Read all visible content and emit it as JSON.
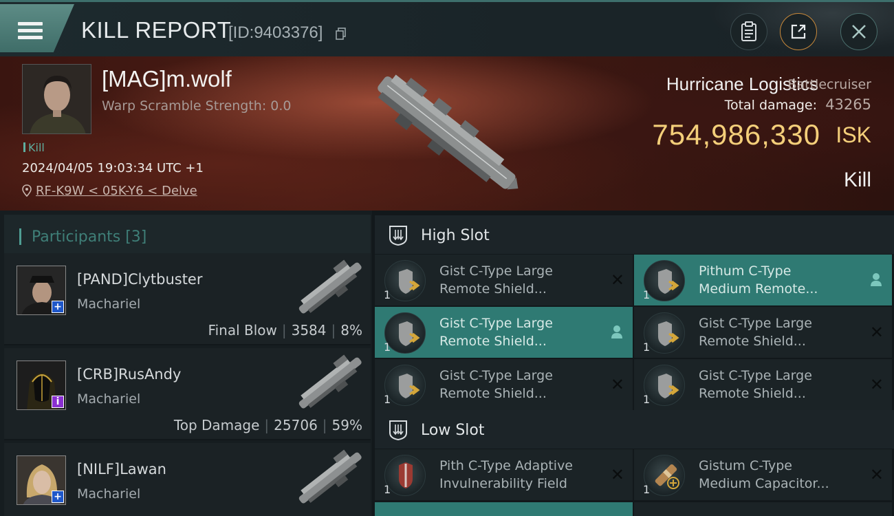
{
  "header": {
    "title": "KILL REPORT",
    "report_id": "[ID:9403376]",
    "icons": [
      "menu-icon",
      "copy-icon",
      "clipboard-icon",
      "share-icon",
      "close-icon"
    ]
  },
  "victim": {
    "name": "[MAG]m.wolf",
    "warp": "Warp Scramble Strength: 0.0",
    "tag": "Kill",
    "datetime": "2024/04/05 19:03:34 UTC +1",
    "location": "RF-K9W < 05K-Y6 < Delve",
    "ship_name": "Hurricane Logistics",
    "ship_class": "Battlecruiser",
    "total_damage_label": "Total damage:",
    "total_damage": "43265",
    "isk_value": "754,986,330",
    "isk_unit": "ISK",
    "result": "Kill"
  },
  "participants": {
    "title": "Participants [3]",
    "items": [
      {
        "name": "[PAND]Clytbuster",
        "ship": "Machariel",
        "role": "Final Blow",
        "damage": "3584",
        "percent": "8%",
        "badge": "+",
        "badge_color": "#1f57c9"
      },
      {
        "name": "[CRB]RusAndy",
        "ship": "Machariel",
        "role": "Top Damage",
        "damage": "25706",
        "percent": "59%",
        "badge": "i",
        "badge_color": "#8a2fd0"
      },
      {
        "name": "[NILF]Lawan",
        "ship": "Machariel",
        "role": "",
        "damage": "",
        "percent": "",
        "badge": "+",
        "badge_color": "#1f57c9"
      }
    ]
  },
  "slots": {
    "high": {
      "title": "High Slot",
      "modules": [
        {
          "line1": "Gist C-Type Large",
          "line2": "Remote Shield...",
          "qty": "1",
          "active": false,
          "status": "close-icon"
        },
        {
          "line1": "Pithum C-Type",
          "line2": "Medium Remote...",
          "qty": "1",
          "active": true,
          "status": "user-icon"
        },
        {
          "line1": "Gist C-Type Large",
          "line2": "Remote Shield...",
          "qty": "1",
          "active": true,
          "status": "user-icon"
        },
        {
          "line1": "Gist C-Type Large",
          "line2": "Remote Shield...",
          "qty": "1",
          "active": false,
          "status": "close-icon"
        },
        {
          "line1": "Gist C-Type Large",
          "line2": "Remote Shield...",
          "qty": "1",
          "active": false,
          "status": "close-icon"
        },
        {
          "line1": "Gist C-Type Large",
          "line2": "Remote Shield...",
          "qty": "1",
          "active": false,
          "status": "close-icon"
        }
      ]
    },
    "low": {
      "title": "Low Slot",
      "modules": [
        {
          "line1": "Pith C-Type Adaptive",
          "line2": "Invulnerability Field",
          "qty": "1",
          "active": false,
          "status": "close-icon"
        },
        {
          "line1": "Gistum C-Type",
          "line2": "Medium Capacitor...",
          "qty": "1",
          "active": false,
          "status": "close-icon"
        }
      ]
    }
  }
}
